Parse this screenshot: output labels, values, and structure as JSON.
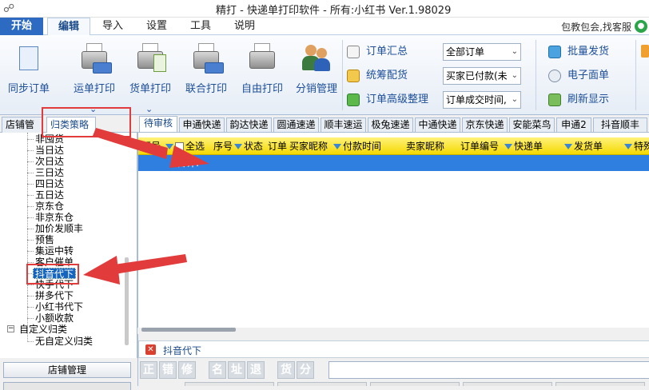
{
  "titlebar": {
    "title": "精打 - 快递单打印软件 - 所有:小红书 Ver.1.98029"
  },
  "menubar": {
    "items": [
      "开始",
      "编辑",
      "导入",
      "设置",
      "工具",
      "说明"
    ],
    "promo": "包教包会,找客服",
    "chat_icon": "chat-icon"
  },
  "ribbon": {
    "buttons": [
      "同步订单",
      "运单打印",
      "货单打印",
      "联合打印",
      "自由打印",
      "分销管理"
    ],
    "small_buttons": [
      "订单汇总",
      "统筹配货",
      "订单高级整理"
    ],
    "combos": [
      "全部订单",
      "买家已付款(未",
      "订单成交时间,"
    ],
    "right_buttons": [
      "批量发货",
      "电子面单",
      "刷新显示"
    ]
  },
  "left_panel": {
    "tabs": [
      "店铺管理",
      "归类策略"
    ],
    "tree_items": [
      "非囤货",
      "当日达",
      "次日达",
      "三日达",
      "四日达",
      "五日达",
      "京东仓",
      "非京东仓",
      "加价发顺丰",
      "预售",
      "集运中转",
      "客户催单",
      "抖音代下",
      "快手代下",
      "拼多代下",
      "小红书代下",
      "小额收款"
    ],
    "selected_item": "抖音代下",
    "custom_group": "自定义归类",
    "custom_child": "无自定义归类",
    "bottom_button": "店铺管理"
  },
  "right_panel": {
    "tabs": [
      "待审核",
      "申通快递",
      "韵达快递",
      "圆通速递",
      "顺丰速运",
      "极兔速递",
      "中通快递",
      "京东快递",
      "安能菜鸟",
      "申通2",
      "抖音顺丰"
    ],
    "active_tab": "待审核",
    "columns": {
      "row_no": "行号",
      "select_all": "全选",
      "seq": "序号",
      "status": "状态",
      "order_short": "订单",
      "buyer_nick": "买家昵称",
      "pay_time": "付款时间",
      "seller_nick": "卖家昵称",
      "order_no": "订单编号",
      "express_no": "快递单",
      "ship_no": "发货单",
      "special": "特殊"
    },
    "total_label": "合计:"
  },
  "bottom": {
    "filter_label": "抖音代下",
    "quick_buttons": [
      "正",
      "错",
      "修",
      "名",
      "址",
      "退",
      "货",
      "分"
    ]
  }
}
